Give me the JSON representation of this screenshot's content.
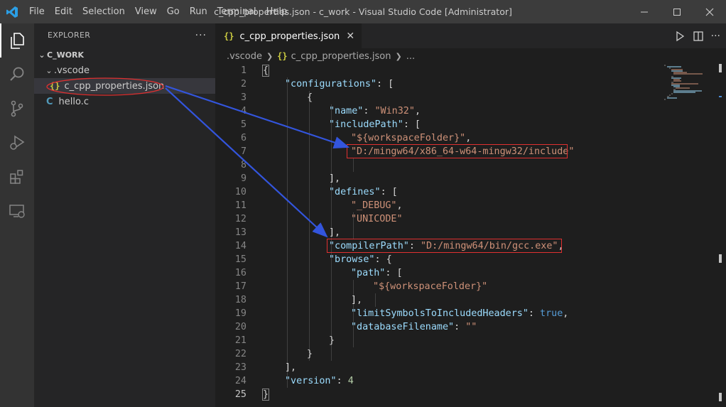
{
  "titlebar": {
    "menu": [
      "File",
      "Edit",
      "Selection",
      "View",
      "Go",
      "Run",
      "Terminal",
      "Help"
    ],
    "window_title": "c_cpp_properties.json - c_work - Visual Studio Code [Administrator]"
  },
  "sidebar": {
    "title": "EXPLORER",
    "more": "···",
    "folder": "C_WORK",
    "subfolder": ".vscode",
    "files": [
      {
        "name": "c_cpp_properties.json",
        "icon": "json-icon",
        "glyph": "{}"
      },
      {
        "name": "hello.c",
        "icon": "c-file-icon",
        "glyph": "C"
      }
    ]
  },
  "editor": {
    "tab": {
      "label": "c_cpp_properties.json",
      "glyph": "{}"
    },
    "breadcrumb": [
      ".vscode",
      "c_cpp_properties.json",
      "..."
    ],
    "lines": [
      {
        "n": "1"
      },
      {
        "n": "2"
      },
      {
        "n": "3"
      },
      {
        "n": "4"
      },
      {
        "n": "5"
      },
      {
        "n": "6"
      },
      {
        "n": "7"
      },
      {
        "n": "8"
      },
      {
        "n": "9"
      },
      {
        "n": "10"
      },
      {
        "n": "11"
      },
      {
        "n": "12"
      },
      {
        "n": "13"
      },
      {
        "n": "14"
      },
      {
        "n": "15"
      },
      {
        "n": "16"
      },
      {
        "n": "17"
      },
      {
        "n": "18"
      },
      {
        "n": "19"
      },
      {
        "n": "20"
      },
      {
        "n": "21"
      },
      {
        "n": "22"
      },
      {
        "n": "23"
      },
      {
        "n": "24"
      },
      {
        "n": "25"
      }
    ],
    "code": {
      "l1": "{",
      "l2_key": "\"configurations\"",
      "l2_rest": ": [",
      "l3": "{",
      "l4_key": "\"name\"",
      "l4_val": "\"Win32\"",
      "l5_key": "\"includePath\"",
      "l5_rest": ": [",
      "l6_val": "\"${workspaceFolder}\"",
      "l7_val": "\"D:/mingw64/x86_64-w64-mingw32/include\"",
      "l9": "],",
      "l10_key": "\"defines\"",
      "l10_rest": ": [",
      "l11_val": "\"_DEBUG\"",
      "l12_val": "\"UNICODE\"",
      "l13": "],",
      "l14_key": "\"compilerPath\"",
      "l14_val": "\"D:/mingw64/bin/gcc.exe\"",
      "l15_key": "\"browse\"",
      "l15_rest": ": {",
      "l16_key": "\"path\"",
      "l16_rest": ": [",
      "l17_val": "\"${workspaceFolder}\"",
      "l18": "],",
      "l19_key": "\"limitSymbolsToIncludedHeaders\"",
      "l19_val": "true",
      "l20_key": "\"databaseFilename\"",
      "l20_val": "\"\"",
      "l21": "}",
      "l22": "}",
      "l23": "],",
      "l24_key": "\"version\"",
      "l24_val": "4",
      "l25": "}"
    }
  },
  "colors": {
    "key": "#9cdcfe",
    "string": "#ce9178",
    "boolean": "#569cd6",
    "number": "#b5cea8",
    "annotation": "#3355dd",
    "highlight": "#e03030"
  }
}
